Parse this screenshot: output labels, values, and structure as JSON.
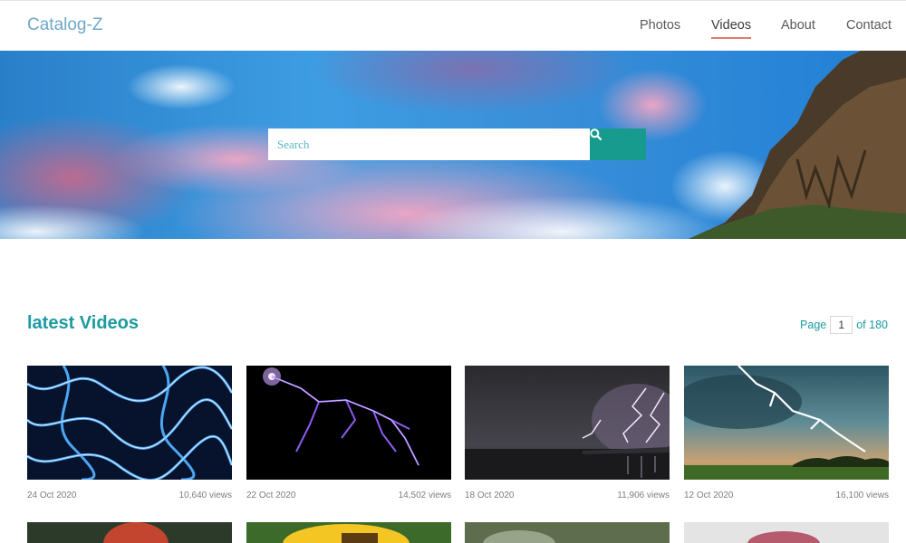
{
  "nav": {
    "brand": "Catalog-Z",
    "links": [
      {
        "label": "Photos"
      },
      {
        "label": "Videos"
      },
      {
        "label": "About"
      },
      {
        "label": "Contact"
      }
    ]
  },
  "search": {
    "placeholder": "Search"
  },
  "section": {
    "title": "latest Videos",
    "page_prefix": "Page",
    "page_value": "1",
    "page_suffix": "of 180"
  },
  "videos": [
    {
      "date": "24 Oct 2020",
      "views": "10,640 views"
    },
    {
      "date": "22 Oct 2020",
      "views": "14,502 views"
    },
    {
      "date": "18 Oct 2020",
      "views": "11,906 views"
    },
    {
      "date": "12 Oct 2020",
      "views": "16,100 views"
    }
  ],
  "colors": {
    "accent": "#169b8e",
    "heading": "#1d9aa0",
    "brand": "#6fa8c7",
    "nav_underline": "#e27b6f"
  }
}
